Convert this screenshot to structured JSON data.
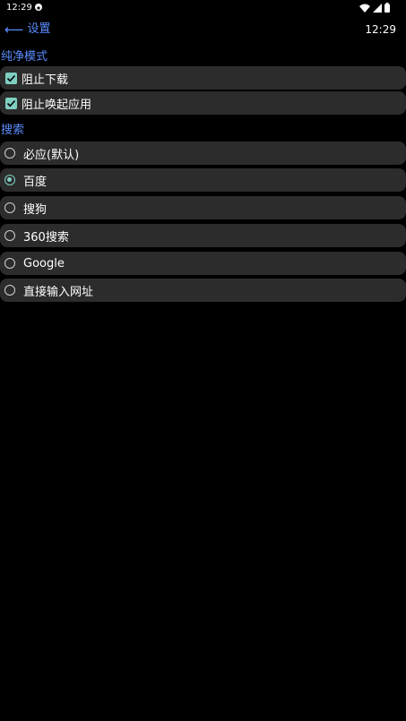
{
  "status_bar": {
    "time": "12:29"
  },
  "header": {
    "back_arrow": "⟵",
    "title": "设置",
    "clock": "12:29"
  },
  "pure_mode": {
    "title": "纯净模式",
    "items": [
      {
        "label": "阻止下载",
        "checked": true
      },
      {
        "label": "阻止唤起应用",
        "checked": true
      }
    ]
  },
  "search": {
    "title": "搜索",
    "selected": "百度",
    "options": [
      {
        "label": "必应(默认)"
      },
      {
        "label": "百度"
      },
      {
        "label": "搜狗"
      },
      {
        "label": "360搜索"
      },
      {
        "label": "Google"
      },
      {
        "label": "直接输入网址"
      }
    ]
  },
  "colors": {
    "accent": "#5b8cff",
    "checked": "#7fcfc1",
    "row_bg": "#2c2c2c",
    "background": "#000000"
  }
}
